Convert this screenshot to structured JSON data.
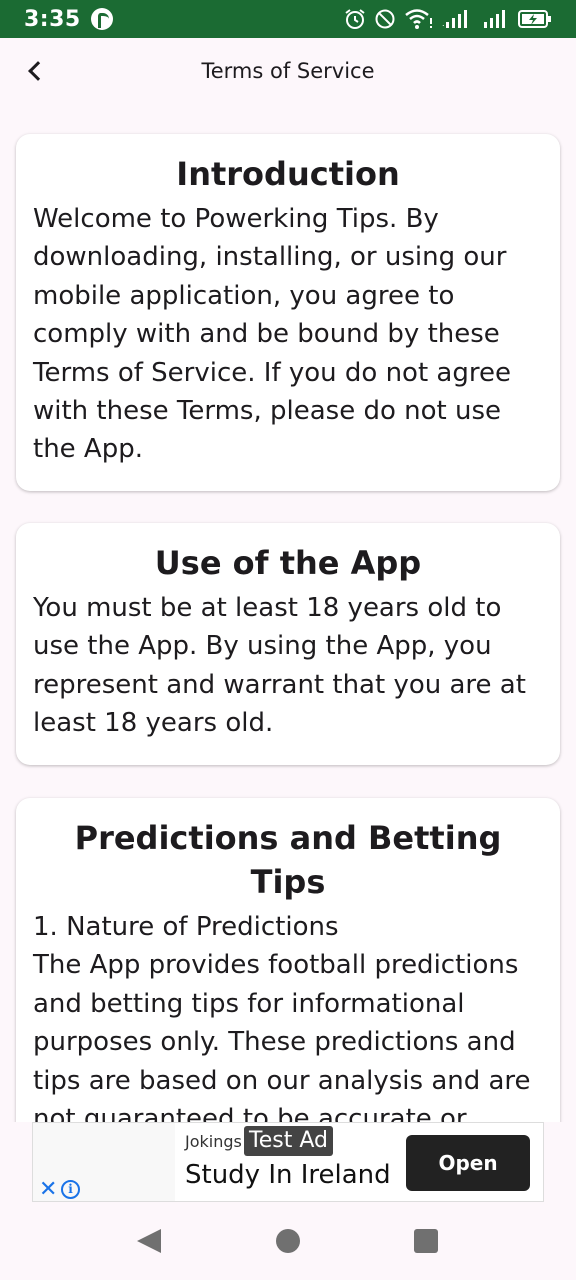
{
  "status_bar": {
    "time": "3:35",
    "icons": [
      "app-notification-icon",
      "alarm-icon",
      "do-not-disturb-icon",
      "wifi-icon",
      "cell-signal-icon",
      "cell-signal-icon",
      "battery-charging-icon"
    ]
  },
  "app_bar": {
    "title": "Terms of Service",
    "back_icon": "chevron-left-icon"
  },
  "sections": [
    {
      "title": "Introduction",
      "body": "Welcome to Powerking Tips. By downloading, installing, or using our mobile application, you agree to comply with and be bound by these Terms of Service. If you do not agree with these Terms, please do not use the App."
    },
    {
      "title": "Use of the App",
      "body": "You must be at least 18 years old to use the App. By using the App, you represent and warrant that you are at least 18 years old."
    },
    {
      "title": "Predictions and Betting Tips",
      "body": "1. Nature of Predictions\nThe App provides football predictions and betting tips for informational purposes only. These predictions and tips are based on our analysis and are not guaranteed to be accurate or reliable."
    }
  ],
  "ad": {
    "advertiser": "Jokings",
    "badge": "Test Ad",
    "headline": "Study In Ireland",
    "cta": "Open",
    "close_icon": "close-icon",
    "info_icon": "info-icon"
  },
  "nav_bar": {
    "icons": [
      "back-triangle-icon",
      "home-circle-icon",
      "recents-square-icon"
    ]
  },
  "colors": {
    "status_bar": "#1b6b33",
    "background": "#fdf7fb",
    "card": "#ffffff",
    "ad_button": "#222222",
    "ad_icons": "#1a73e8"
  }
}
